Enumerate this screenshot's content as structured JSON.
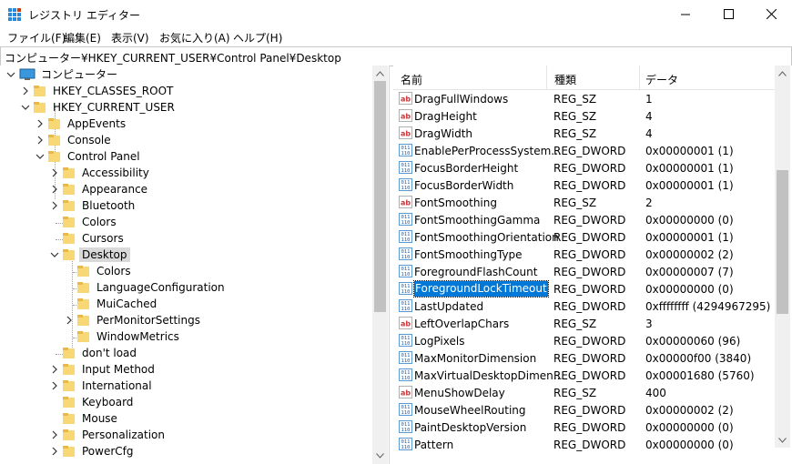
{
  "window": {
    "title": "レジストリ エディター"
  },
  "menu": [
    "ファイル(F)",
    "編集(E)",
    "表示(V)",
    "お気に入り(A)",
    "ヘルプ(H)"
  ],
  "address": "コンピューター¥HKEY_CURRENT_USER¥Control Panel¥Desktop",
  "tree": {
    "root": "コンピューター",
    "hkcr": "HKEY_CLASSES_ROOT",
    "hkcu": "HKEY_CURRENT_USER",
    "appevents": "AppEvents",
    "console": "Console",
    "control_panel": "Control Panel",
    "cp_children": [
      "Accessibility",
      "Appearance",
      "Bluetooth",
      "Colors",
      "Cursors"
    ],
    "desktop": "Desktop",
    "desktop_children": [
      "Colors",
      "LanguageConfiguration",
      "MuiCached",
      "PerMonitorSettings",
      "WindowMetrics"
    ],
    "cp_after": [
      "don't load",
      "Input Method",
      "International",
      "Keyboard",
      "Mouse",
      "Personalization",
      "PowerCfg"
    ]
  },
  "list": {
    "headers": {
      "name": "名前",
      "type": "種類",
      "data": "データ"
    },
    "rows": [
      {
        "icon": "string",
        "name": "DragFullWindows",
        "type": "REG_SZ",
        "data": "1"
      },
      {
        "icon": "string",
        "name": "DragHeight",
        "type": "REG_SZ",
        "data": "4"
      },
      {
        "icon": "string",
        "name": "DragWidth",
        "type": "REG_SZ",
        "data": "4"
      },
      {
        "icon": "binary",
        "name": "EnablePerProcessSystem...",
        "type": "REG_DWORD",
        "data": "0x00000001 (1)"
      },
      {
        "icon": "binary",
        "name": "FocusBorderHeight",
        "type": "REG_DWORD",
        "data": "0x00000001 (1)"
      },
      {
        "icon": "binary",
        "name": "FocusBorderWidth",
        "type": "REG_DWORD",
        "data": "0x00000001 (1)"
      },
      {
        "icon": "string",
        "name": "FontSmoothing",
        "type": "REG_SZ",
        "data": "2"
      },
      {
        "icon": "binary",
        "name": "FontSmoothingGamma",
        "type": "REG_DWORD",
        "data": "0x00000000 (0)"
      },
      {
        "icon": "binary",
        "name": "FontSmoothingOrientation",
        "type": "REG_DWORD",
        "data": "0x00000001 (1)"
      },
      {
        "icon": "binary",
        "name": "FontSmoothingType",
        "type": "REG_DWORD",
        "data": "0x00000002 (2)"
      },
      {
        "icon": "binary",
        "name": "ForegroundFlashCount",
        "type": "REG_DWORD",
        "data": "0x00000007 (7)"
      },
      {
        "icon": "binary",
        "name": "ForegroundLockTimeout",
        "type": "REG_DWORD",
        "data": "0x00000000 (0)",
        "selected": true
      },
      {
        "icon": "binary",
        "name": "LastUpdated",
        "type": "REG_DWORD",
        "data": "0xffffffff (4294967295)"
      },
      {
        "icon": "string",
        "name": "LeftOverlapChars",
        "type": "REG_SZ",
        "data": "3"
      },
      {
        "icon": "binary",
        "name": "LogPixels",
        "type": "REG_DWORD",
        "data": "0x00000060 (96)"
      },
      {
        "icon": "binary",
        "name": "MaxMonitorDimension",
        "type": "REG_DWORD",
        "data": "0x00000f00 (3840)"
      },
      {
        "icon": "binary",
        "name": "MaxVirtualDesktopDimen...",
        "type": "REG_DWORD",
        "data": "0x00001680 (5760)"
      },
      {
        "icon": "string",
        "name": "MenuShowDelay",
        "type": "REG_SZ",
        "data": "400"
      },
      {
        "icon": "binary",
        "name": "MouseWheelRouting",
        "type": "REG_DWORD",
        "data": "0x00000002 (2)"
      },
      {
        "icon": "binary",
        "name": "PaintDesktopVersion",
        "type": "REG_DWORD",
        "data": "0x00000000 (0)"
      },
      {
        "icon": "binary",
        "name": "Pattern",
        "type": "REG_DWORD",
        "data": "0x00000000 (0)"
      }
    ]
  },
  "colors": {
    "selection": "#0078d7",
    "tree_selection": "#d9d9d9",
    "folder": "#f8d775",
    "scrollbar_thumb": "#c1c1c1"
  }
}
